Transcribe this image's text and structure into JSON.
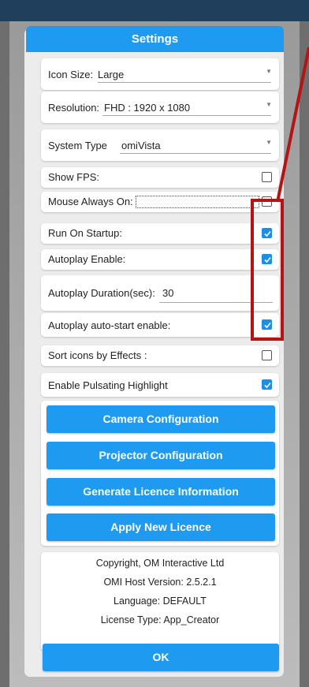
{
  "window": {
    "title": "Settings"
  },
  "dropdowns": {
    "icon_size": {
      "label": "Icon Size:",
      "value": "Large"
    },
    "resolution": {
      "label": "Resolution:",
      "value": "FHD : 1920 x 1080"
    },
    "system_type": {
      "label": "System Type",
      "value": "omiVista"
    }
  },
  "options": {
    "show_fps": {
      "label": "Show FPS:",
      "checked": false
    },
    "mouse_always_on": {
      "label": "Mouse Always On:",
      "checked": false
    },
    "run_on_startup": {
      "label": "Run On Startup:",
      "checked": true
    },
    "autoplay_enable": {
      "label": "Autoplay Enable:",
      "checked": true
    },
    "autoplay_duration": {
      "label": "Autoplay Duration(sec):",
      "value": "30"
    },
    "autoplay_auto_start": {
      "label": "Autoplay auto-start enable:",
      "checked": true
    },
    "sort_icons": {
      "label": "Sort icons by Effects :",
      "checked": false
    },
    "pulsating_highlight": {
      "label": "Enable Pulsating Highlight",
      "checked": true
    }
  },
  "buttons": {
    "camera": "Camera Configuration",
    "projector": "Projector Configuration",
    "generate_licence": "Generate Licence Information",
    "apply_licence": "Apply New Licence",
    "ok": "OK"
  },
  "info": {
    "copyright": "Copyright, OM Interactive Ltd",
    "host_version": "OMI Host Version: 2.5.2.1",
    "language": "Language: DEFAULT",
    "license_type": "License Type: App_Creator"
  },
  "colors": {
    "accent": "#1e9bf0",
    "checkbox_on": "#1a8fe8",
    "highlight": "#b51414",
    "top_bar": "#1f3f5c"
  }
}
